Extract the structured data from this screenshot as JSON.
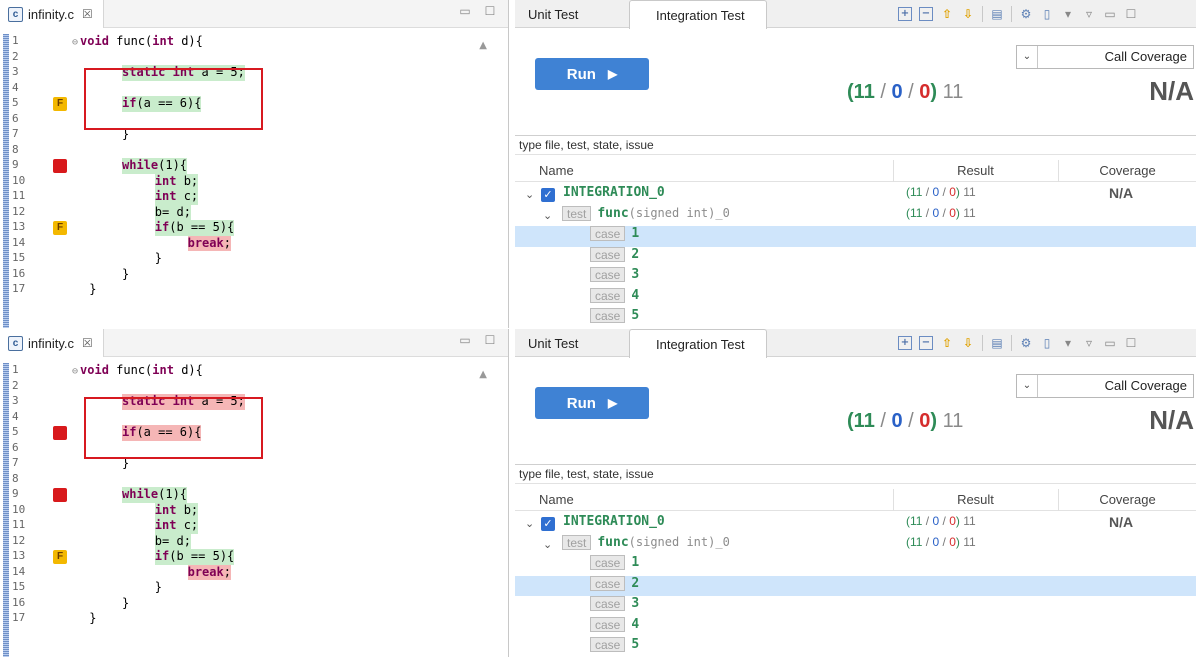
{
  "panes": [
    {
      "editor": {
        "filename": "infinity.c",
        "close_glyph": "☒",
        "lines": [
          {
            "n": "1",
            "code": "void func(int d){",
            "indent": 0,
            "fold": true,
            "hl": "",
            "marker": ""
          },
          {
            "n": "2",
            "code": "",
            "indent": 0,
            "hl": "",
            "marker": ""
          },
          {
            "n": "3",
            "code": "static int a = 5;",
            "indent": 4,
            "hl": "green",
            "marker": ""
          },
          {
            "n": "4",
            "code": "",
            "indent": 0,
            "hl": "",
            "marker": ""
          },
          {
            "n": "5",
            "code": "if(a == 6){",
            "indent": 4,
            "hl": "green",
            "marker": "F"
          },
          {
            "n": "6",
            "code": "",
            "indent": 0,
            "hl": "",
            "marker": ""
          },
          {
            "n": "7",
            "code": "}",
            "indent": 4,
            "hl": "",
            "marker": ""
          },
          {
            "n": "8",
            "code": "",
            "indent": 0,
            "hl": "",
            "marker": ""
          },
          {
            "n": "9",
            "code": "while(1){",
            "indent": 4,
            "hl": "green",
            "marker": "red"
          },
          {
            "n": "10",
            "code": "int b;",
            "indent": 8,
            "hl": "green",
            "marker": ""
          },
          {
            "n": "11",
            "code": "int c;",
            "indent": 8,
            "hl": "green",
            "marker": ""
          },
          {
            "n": "12",
            "code": "b= d;",
            "indent": 8,
            "hl": "green",
            "marker": ""
          },
          {
            "n": "13",
            "code": "if(b == 5){",
            "indent": 8,
            "hl": "green",
            "marker": "F"
          },
          {
            "n": "14",
            "code": "break;",
            "indent": 12,
            "hl": "red",
            "marker": ""
          },
          {
            "n": "15",
            "code": "}",
            "indent": 8,
            "hl": "",
            "marker": ""
          },
          {
            "n": "16",
            "code": "}",
            "indent": 4,
            "hl": "",
            "marker": ""
          },
          {
            "n": "17",
            "code": "}",
            "indent": 0,
            "hl": "",
            "marker": ""
          }
        ]
      },
      "tests": {
        "tab_unit": "Unit Test",
        "tab_integration": "Integration Test",
        "run_label": "Run",
        "coverage_mode": "Call Coverage",
        "summary": {
          "pass": "11",
          "fail": "0",
          "error": "0",
          "total": "11"
        },
        "coverage_big": "N/A",
        "filter_placeholder": "type file, test, state, issue",
        "col_name": "Name",
        "col_result": "Result",
        "col_coverage": "Coverage",
        "suite_name": "INTEGRATION_0",
        "suite_result": {
          "pass": "11",
          "fail": "0",
          "error": "0",
          "total": "11"
        },
        "suite_coverage": "N/A",
        "test_tag": "test",
        "func_name": "func",
        "func_sig": "(signed int)_0",
        "func_result": {
          "pass": "11",
          "fail": "0",
          "error": "0",
          "total": "11"
        },
        "case_tag": "case",
        "cases": [
          "1",
          "2",
          "3",
          "4",
          "5"
        ],
        "selected_case": 0
      }
    },
    {
      "editor": {
        "filename": "infinity.c",
        "close_glyph": "☒",
        "lines": [
          {
            "n": "1",
            "code": "void func(int d){",
            "indent": 0,
            "fold": true,
            "hl": "",
            "marker": ""
          },
          {
            "n": "2",
            "code": "",
            "indent": 0,
            "hl": "",
            "marker": ""
          },
          {
            "n": "3",
            "code": "static int a = 5;",
            "indent": 4,
            "hl": "red",
            "marker": ""
          },
          {
            "n": "4",
            "code": "",
            "indent": 0,
            "hl": "",
            "marker": ""
          },
          {
            "n": "5",
            "code": "if(a == 6){",
            "indent": 4,
            "hl": "red",
            "marker": "red"
          },
          {
            "n": "6",
            "code": "",
            "indent": 0,
            "hl": "",
            "marker": ""
          },
          {
            "n": "7",
            "code": "}",
            "indent": 4,
            "hl": "",
            "marker": ""
          },
          {
            "n": "8",
            "code": "",
            "indent": 0,
            "hl": "",
            "marker": ""
          },
          {
            "n": "9",
            "code": "while(1){",
            "indent": 4,
            "hl": "green",
            "marker": "red"
          },
          {
            "n": "10",
            "code": "int b;",
            "indent": 8,
            "hl": "green",
            "marker": ""
          },
          {
            "n": "11",
            "code": "int c;",
            "indent": 8,
            "hl": "green",
            "marker": ""
          },
          {
            "n": "12",
            "code": "b= d;",
            "indent": 8,
            "hl": "green",
            "marker": ""
          },
          {
            "n": "13",
            "code": "if(b == 5){",
            "indent": 8,
            "hl": "green",
            "marker": "F"
          },
          {
            "n": "14",
            "code": "break;",
            "indent": 12,
            "hl": "red",
            "marker": ""
          },
          {
            "n": "15",
            "code": "}",
            "indent": 8,
            "hl": "",
            "marker": ""
          },
          {
            "n": "16",
            "code": "}",
            "indent": 4,
            "hl": "",
            "marker": ""
          },
          {
            "n": "17",
            "code": "}",
            "indent": 0,
            "hl": "",
            "marker": ""
          }
        ]
      },
      "tests": {
        "tab_unit": "Unit Test",
        "tab_integration": "Integration Test",
        "run_label": "Run",
        "coverage_mode": "Call Coverage",
        "summary": {
          "pass": "11",
          "fail": "0",
          "error": "0",
          "total": "11"
        },
        "coverage_big": "N/A",
        "filter_placeholder": "type file, test, state, issue",
        "col_name": "Name",
        "col_result": "Result",
        "col_coverage": "Coverage",
        "suite_name": "INTEGRATION_0",
        "suite_result": {
          "pass": "11",
          "fail": "0",
          "error": "0",
          "total": "11"
        },
        "suite_coverage": "N/A",
        "test_tag": "test",
        "func_name": "func",
        "func_sig": "(signed int)_0",
        "func_result": {
          "pass": "11",
          "fail": "0",
          "error": "0",
          "total": "11"
        },
        "case_tag": "case",
        "cases": [
          "1",
          "2",
          "3",
          "4",
          "5"
        ],
        "selected_case": 1
      }
    }
  ],
  "colors": {
    "pass": "#2e8b57",
    "fail": "#2a61c7",
    "error": "#d52d2d",
    "covered": "#c9eccc",
    "uncovered": "#f5b6b6",
    "highlight_box": "#d71920",
    "selection": "#cfe5fb",
    "run_button": "#3f82d4"
  }
}
